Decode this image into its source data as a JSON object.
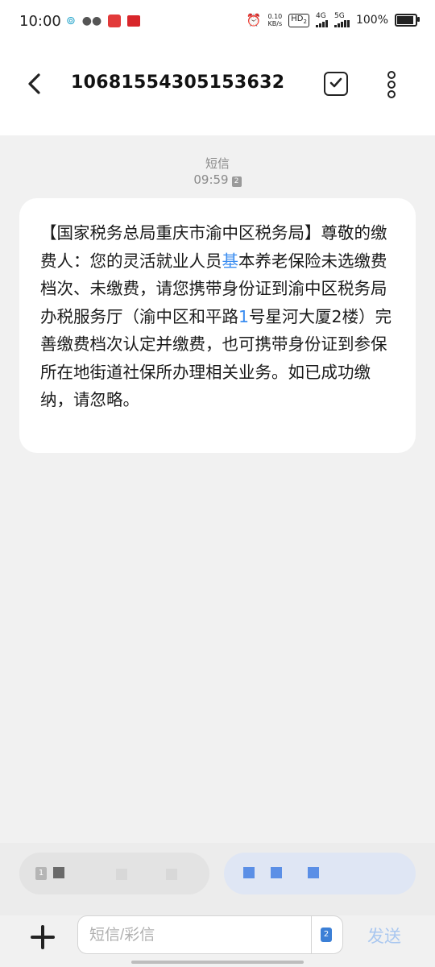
{
  "status_bar": {
    "time": "10:00",
    "net_speed_value": "0.10",
    "net_speed_unit": "KB/s",
    "hd_label": "HD",
    "hd_sub": "2",
    "net1": "4G",
    "net2": "5G",
    "battery_text": "100%",
    "battery_level": 1.0,
    "icons": [
      "alarm-icon",
      "wifi-hotspot-icon",
      "wechat-icon",
      "app-notification-icon",
      "news-app-icon"
    ]
  },
  "header": {
    "title": "10681554305153632",
    "back_icon": "back-arrow-icon",
    "select_icon": "checkbox-icon",
    "more_icon": "more-vertical-icon"
  },
  "thread": {
    "channel_label": "短信",
    "time": "09:59",
    "sim_badge": "2",
    "message": {
      "part1": "【国家税务总局重庆市渝中区税务局】尊敬的缴费人：您的灵活就业人员",
      "highlight1": "基",
      "part2": "本养老保险未选缴费档次、未缴费，请您携带身份证到渝中区税务局办税服务厅（渝中区和平路",
      "highlight2": "1",
      "part3": "号星河大厦2楼）完善缴费档次认定并缴费，也可携带身份证到参保所在地街道社保所办理相关业务。如已成功缴纳，请忽略。"
    }
  },
  "suggestions": {
    "left_sim": "1",
    "right_sim": "2"
  },
  "composer": {
    "placeholder": "短信/彩信",
    "sim_switch": "2",
    "send_label": "发送",
    "add_icon": "plus-icon"
  },
  "colors": {
    "accent": "#3b8df0",
    "send_disabled": "#a9c7f0",
    "background": "#f1f1f1",
    "bubble": "#ffffff"
  }
}
